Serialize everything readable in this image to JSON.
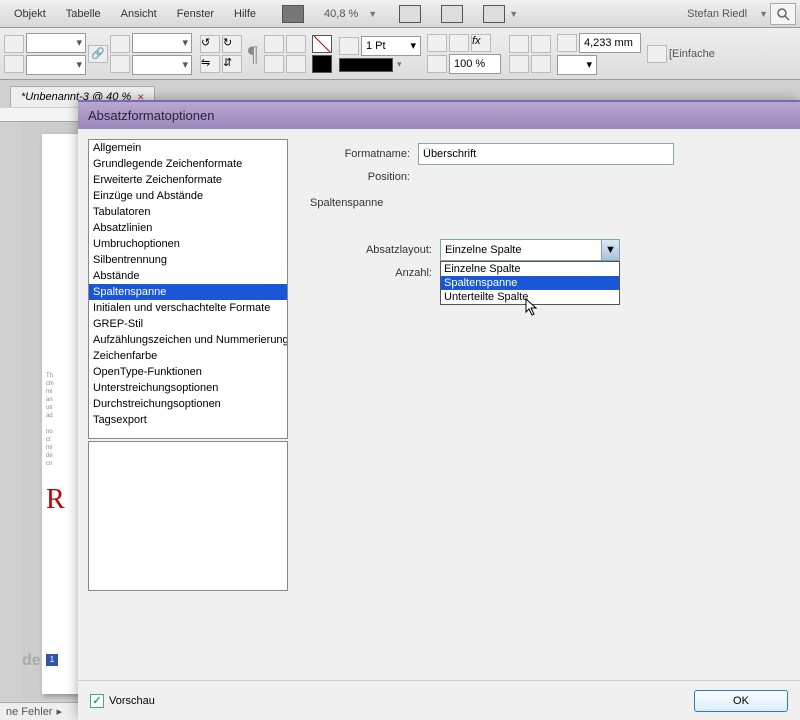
{
  "menu": {
    "items": [
      "Objekt",
      "Tabelle",
      "Ansicht",
      "Fenster",
      "Hilfe"
    ],
    "zoom": "40,8 %",
    "user": "Stefan Riedl"
  },
  "toolbar": {
    "pt": "1 Pt",
    "pct": "100 %",
    "mm": "4,233 mm",
    "mode": "[Einfache"
  },
  "tab": {
    "name": "*Unbenannt-3 @ 40 %",
    "close": "×"
  },
  "page": {
    "bigletter": "R",
    "num": "1",
    "de": "de",
    "status": "ne Fehler"
  },
  "dialog": {
    "title": "Absatzformatoptionen",
    "categories": [
      "Allgemein",
      "Grundlegende Zeichenformate",
      "Erweiterte Zeichenformate",
      "Einzüge und Abstände",
      "Tabulatoren",
      "Absatzlinien",
      "Umbruchoptionen",
      "Silbentrennung",
      "Abstände",
      "Spaltenspanne",
      "Initialen und verschachtelte Formate",
      "GREP-Stil",
      "Aufzählungszeichen und Nummerierung",
      "Zeichenfarbe",
      "OpenType-Funktionen",
      "Unterstreichungsoptionen",
      "Durchstreichungsoptionen",
      "Tagsexport"
    ],
    "sel_index": 9,
    "formatname_label": "Formatname:",
    "formatname_value": "Überschrift",
    "position_label": "Position:",
    "section": "Spaltenspanne",
    "layout_label": "Absatzlayout:",
    "layout_value": "Einzelne Spalte",
    "layout_options": [
      "Einzelne Spalte",
      "Spaltenspanne",
      "Unterteilte Spalte"
    ],
    "layout_hl": 1,
    "count_label": "Anzahl:",
    "preview_label": "Vorschau",
    "ok": "OK"
  }
}
